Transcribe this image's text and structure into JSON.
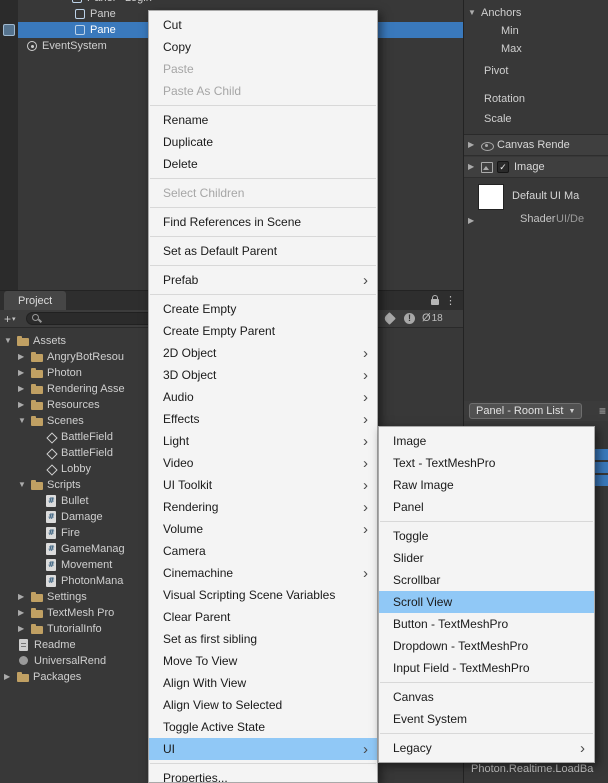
{
  "colors": {
    "selection_blue": "#3a79bc",
    "menu_highlight": "#90c8f6",
    "folder": "#c0a063"
  },
  "hierarchy": {
    "rows": [
      {
        "label": "Panel - Login",
        "icon": "panel-icon",
        "depth": 3,
        "expandable": true,
        "expanded": true
      },
      {
        "label": "Pane",
        "icon": "panel-icon",
        "depth": 4
      },
      {
        "label": "Pane",
        "icon": "panel-icon",
        "depth": 4,
        "selected": true
      },
      {
        "label": "EventSystem",
        "icon": "eventsystem-icon",
        "depth": 1
      }
    ]
  },
  "project": {
    "tab_label": "Project",
    "toolbar": {
      "hidden_count": "18"
    },
    "tree": [
      {
        "label": "Assets",
        "icon": "folder-icon",
        "indent": 0,
        "expandable": true,
        "expanded": true
      },
      {
        "label": "AngryBotResou",
        "icon": "folder-icon",
        "indent": 1,
        "expandable": true
      },
      {
        "label": "Photon",
        "icon": "folder-icon",
        "indent": 1,
        "expandable": true
      },
      {
        "label": "Rendering Asse",
        "icon": "folder-icon",
        "indent": 1,
        "expandable": true
      },
      {
        "label": "Resources",
        "icon": "folder-icon",
        "indent": 1,
        "expandable": true
      },
      {
        "label": "Scenes",
        "icon": "folder-icon",
        "indent": 1,
        "expandable": true,
        "expanded": true
      },
      {
        "label": "BattleField",
        "icon": "scene-icon",
        "indent": 2,
        "reserve": true
      },
      {
        "label": "BattleField",
        "icon": "scene-icon",
        "indent": 2,
        "reserve": true
      },
      {
        "label": "Lobby",
        "icon": "scene-icon",
        "indent": 2,
        "reserve": true
      },
      {
        "label": "Scripts",
        "icon": "folder-icon",
        "indent": 1,
        "expandable": true,
        "expanded": true
      },
      {
        "label": "Bullet",
        "icon": "script-icon",
        "indent": 2,
        "reserve": true
      },
      {
        "label": "Damage",
        "icon": "script-icon",
        "indent": 2,
        "reserve": true
      },
      {
        "label": "Fire",
        "icon": "script-icon",
        "indent": 2,
        "reserve": true
      },
      {
        "label": "GameManag",
        "icon": "script-icon",
        "indent": 2,
        "reserve": true
      },
      {
        "label": "Movement",
        "icon": "script-icon",
        "indent": 2,
        "reserve": true
      },
      {
        "label": "PhotonMana",
        "icon": "script-icon",
        "indent": 2,
        "reserve": true
      },
      {
        "label": "Settings",
        "icon": "folder-icon",
        "indent": 1,
        "expandable": true
      },
      {
        "label": "TextMesh Pro",
        "icon": "folder-icon",
        "indent": 1,
        "expandable": true
      },
      {
        "label": "TutorialInfo",
        "icon": "folder-icon",
        "indent": 1,
        "expandable": true
      },
      {
        "label": "Readme",
        "icon": "readme-icon",
        "indent": 1
      },
      {
        "label": "UniversalRend",
        "icon": "asset-icon",
        "indent": 1
      },
      {
        "label": "Packages",
        "icon": "folder-icon",
        "indent": 0,
        "expandable": true
      }
    ]
  },
  "inspector": {
    "anchors_label": "Anchors",
    "min_label": "Min",
    "max_label": "Max",
    "pivot_label": "Pivot",
    "rotation_label": "Rotation",
    "scale_label": "Scale",
    "canvas_renderer_label": "Canvas Rende",
    "image_label": "Image",
    "material_name": "Default UI Ma",
    "shader_label": "Shader",
    "shader_value": "UI/De",
    "room_list_label": "Panel - Room List",
    "status_text": "Photon.Realtime.LoadBa"
  },
  "context_menu": {
    "groups": [
      {
        "items": [
          {
            "label": "Cut"
          },
          {
            "label": "Copy"
          },
          {
            "label": "Paste",
            "disabled": true
          },
          {
            "label": "Paste As Child",
            "disabled": true
          }
        ]
      },
      {
        "items": [
          {
            "label": "Rename"
          },
          {
            "label": "Duplicate"
          },
          {
            "label": "Delete"
          }
        ]
      },
      {
        "items": [
          {
            "label": "Select Children",
            "disabled": true
          }
        ]
      },
      {
        "items": [
          {
            "label": "Find References in Scene"
          }
        ]
      },
      {
        "items": [
          {
            "label": "Set as Default Parent"
          }
        ]
      },
      {
        "items": [
          {
            "label": "Prefab",
            "submenu": true
          }
        ]
      },
      {
        "items": [
          {
            "label": "Create Empty"
          },
          {
            "label": "Create Empty Parent"
          },
          {
            "label": "2D Object",
            "submenu": true
          },
          {
            "label": "3D Object",
            "submenu": true
          },
          {
            "label": "Audio",
            "submenu": true
          },
          {
            "label": "Effects",
            "submenu": true
          },
          {
            "label": "Light",
            "submenu": true
          },
          {
            "label": "Video",
            "submenu": true
          },
          {
            "label": "UI Toolkit",
            "submenu": true
          },
          {
            "label": "Rendering",
            "submenu": true
          },
          {
            "label": "Volume",
            "submenu": true
          },
          {
            "label": "Camera"
          },
          {
            "label": "Cinemachine",
            "submenu": true
          },
          {
            "label": "Visual Scripting Scene Variables"
          },
          {
            "label": "Clear Parent"
          },
          {
            "label": "Set as first sibling"
          },
          {
            "label": "Move To View"
          },
          {
            "label": "Align With View"
          },
          {
            "label": "Align View to Selected"
          },
          {
            "label": "Toggle Active State"
          },
          {
            "label": "UI",
            "submenu": true,
            "highlighted": true
          }
        ]
      },
      {
        "items": [
          {
            "label": "Properties..."
          }
        ]
      }
    ]
  },
  "ui_submenu": {
    "groups": [
      {
        "items": [
          {
            "label": "Image"
          },
          {
            "label": "Text - TextMeshPro"
          },
          {
            "label": "Raw Image"
          },
          {
            "label": "Panel"
          }
        ]
      },
      {
        "items": [
          {
            "label": "Toggle"
          },
          {
            "label": "Slider"
          },
          {
            "label": "Scrollbar"
          },
          {
            "label": "Scroll View",
            "highlighted": true
          },
          {
            "label": "Button - TextMeshPro"
          },
          {
            "label": "Dropdown - TextMeshPro"
          },
          {
            "label": "Input Field - TextMeshPro"
          }
        ]
      },
      {
        "items": [
          {
            "label": "Canvas"
          },
          {
            "label": "Event System"
          }
        ]
      },
      {
        "items": [
          {
            "label": "Legacy",
            "submenu": true
          }
        ]
      }
    ]
  }
}
